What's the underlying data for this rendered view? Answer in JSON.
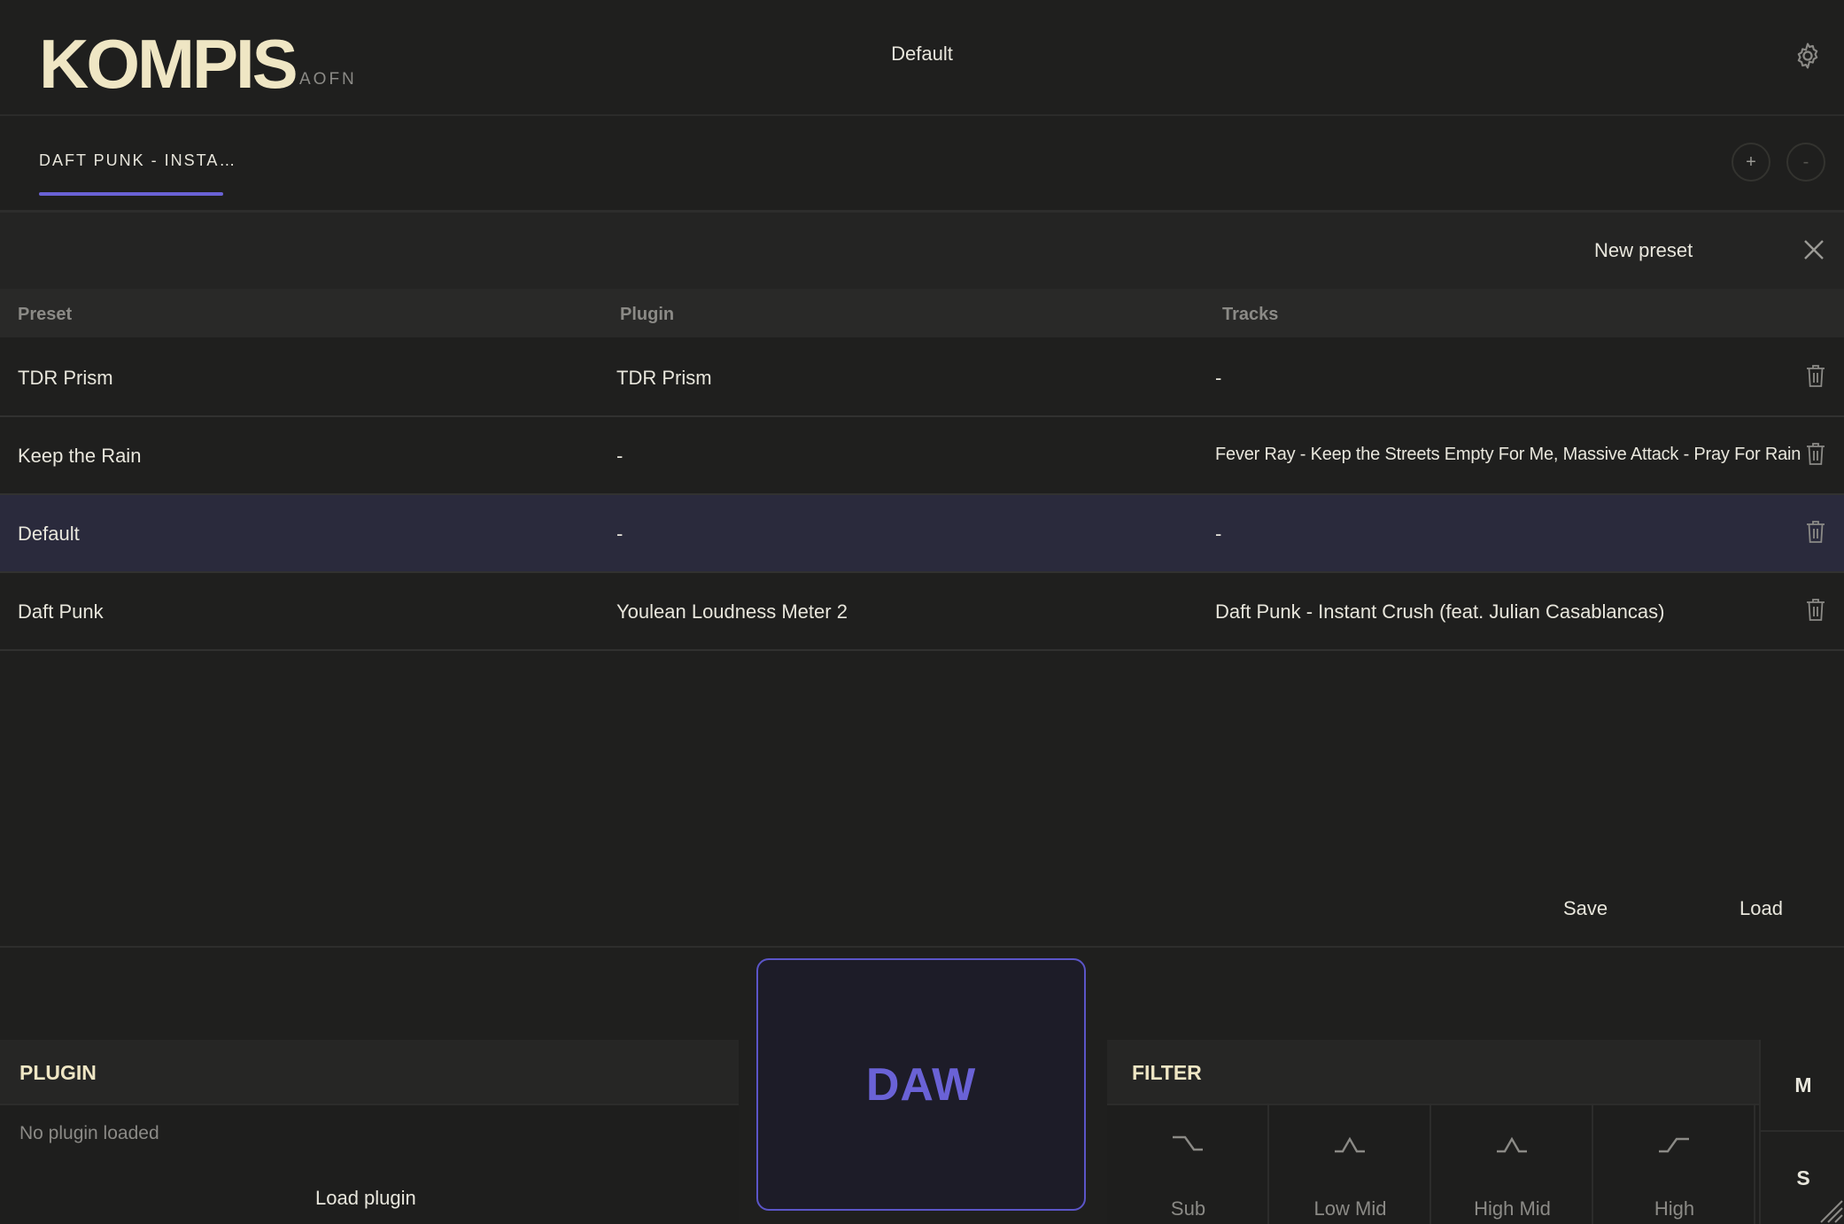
{
  "header": {
    "logo": "KOMPIS",
    "logo_sub": "AOFN",
    "current_preset": "Default"
  },
  "tabs": [
    {
      "label": "DAFT PUNK - INSTA…"
    }
  ],
  "tab_controls": {
    "add": "+",
    "remove": "-"
  },
  "preset_panel": {
    "new_preset_label": "New preset",
    "columns": [
      "Preset",
      "Plugin",
      "Tracks"
    ],
    "rows": [
      {
        "preset": "TDR Prism",
        "plugin": "TDR Prism",
        "tracks": "-"
      },
      {
        "preset": "Keep the Rain",
        "plugin": "-",
        "tracks": "Fever Ray - Keep the Streets Empty For Me, Massive Attack - Pray For Rain"
      },
      {
        "preset": "Default",
        "plugin": "-",
        "tracks": "-"
      },
      {
        "preset": "Daft Punk",
        "plugin": "Youlean Loudness Meter 2",
        "tracks": "Daft Punk - Instant Crush (feat. Julian Casablancas)"
      }
    ],
    "selected_row": 2,
    "save_label": "Save",
    "load_label": "Load"
  },
  "plugin_panel": {
    "title": "PLUGIN",
    "status": "No plugin loaded",
    "load_label": "Load plugin"
  },
  "daw_label": "DAW",
  "filter_panel": {
    "title": "FILTER",
    "bands": [
      {
        "label": "Sub",
        "icon": "low-shelf-curve-icon"
      },
      {
        "label": "Low Mid",
        "icon": "peak-curve-icon"
      },
      {
        "label": "High Mid",
        "icon": "peak-curve-icon"
      },
      {
        "label": "High",
        "icon": "high-shelf-curve-icon"
      }
    ]
  },
  "mute_label": "M",
  "solo_label": "S",
  "colors": {
    "accent": "#6a62d6",
    "background": "#1f1f1e",
    "logo": "#efe6c4",
    "selected_row": "#2a2a3c"
  }
}
